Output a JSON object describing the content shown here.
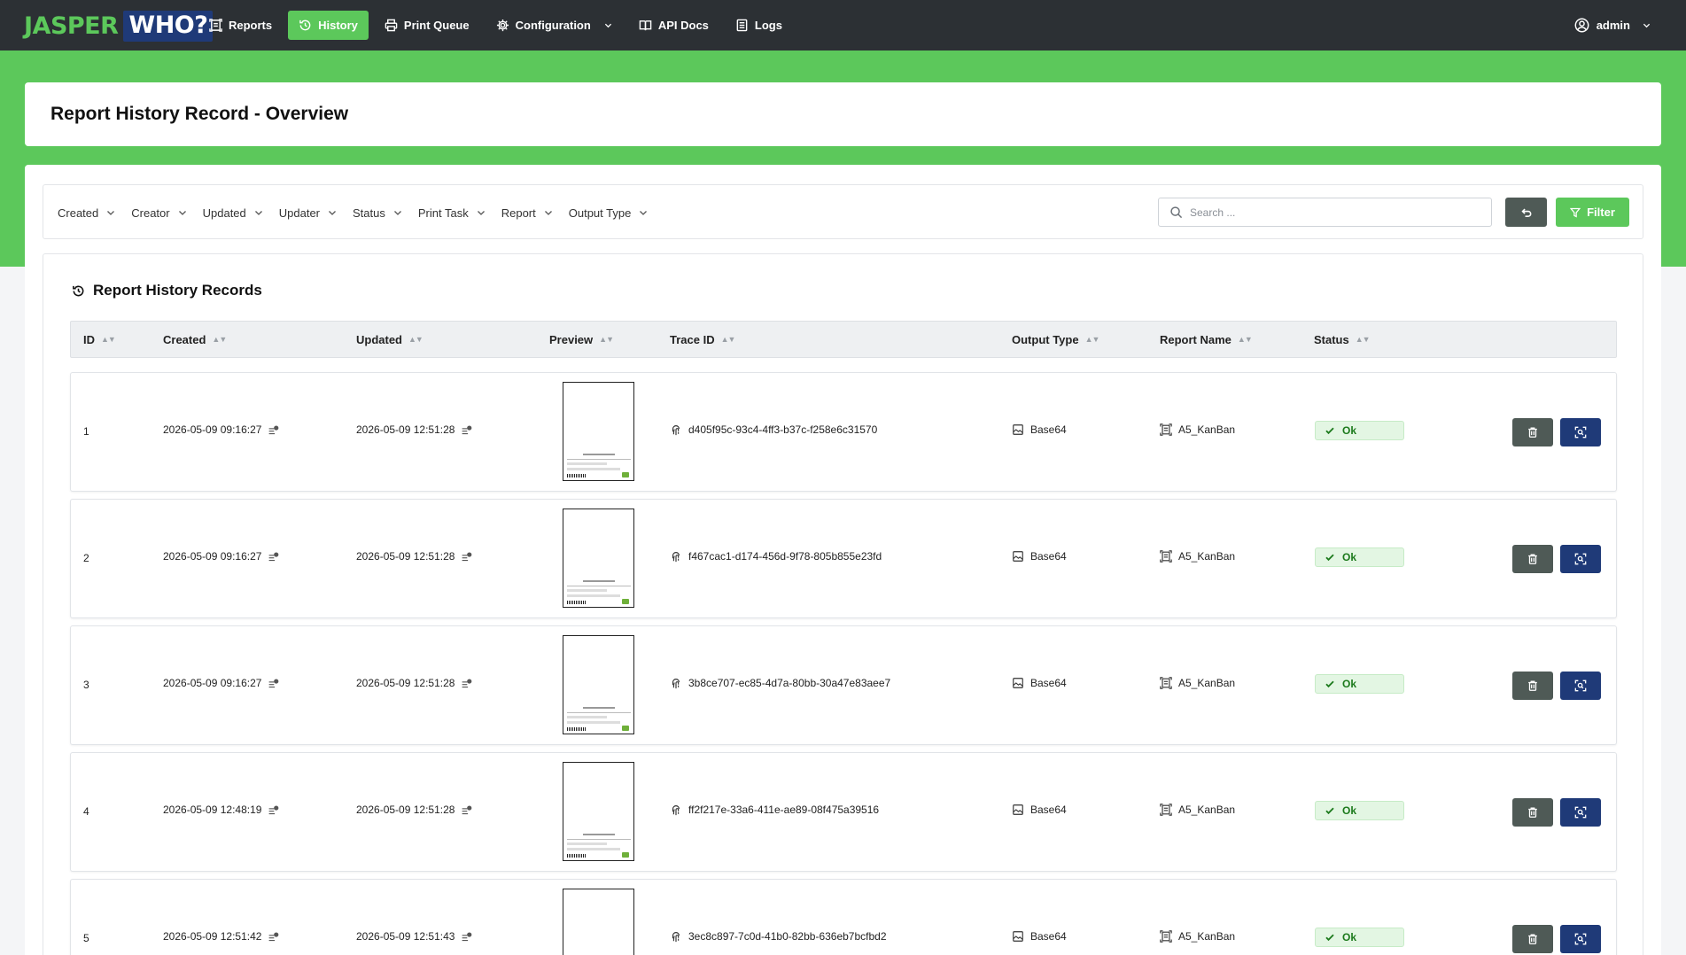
{
  "logo": {
    "part1": "JASPER",
    "part2": "WHO?"
  },
  "nav": {
    "items": [
      {
        "label": "Reports",
        "icon": "report-icon"
      },
      {
        "label": "History",
        "icon": "history-icon",
        "active": true
      },
      {
        "label": "Print Queue",
        "icon": "printer-icon"
      },
      {
        "label": "Configuration",
        "icon": "gear-icon",
        "dropdown": true
      },
      {
        "label": "API Docs",
        "icon": "book-icon"
      },
      {
        "label": "Logs",
        "icon": "list-icon"
      }
    ],
    "user": {
      "name": "admin",
      "icon": "user-circle-icon"
    }
  },
  "page": {
    "title": "Report History Record - Overview"
  },
  "filters": {
    "items": [
      "Created",
      "Creator",
      "Updated",
      "Updater",
      "Status",
      "Print Task",
      "Report",
      "Output Type"
    ],
    "search_placeholder": "Search ...",
    "filter_label": "Filter"
  },
  "records": {
    "title": "Report History Records",
    "columns": {
      "id": "ID",
      "created": "Created",
      "updated": "Updated",
      "preview": "Preview",
      "trace_id": "Trace ID",
      "output_type": "Output Type",
      "report_name": "Report Name",
      "status": "Status"
    },
    "rows": [
      {
        "id": "1",
        "created": "2026-05-09 09:16:27",
        "updated": "2026-05-09 12:51:28",
        "trace_id": "d405f95c-93c4-4ff3-b37c-f258e6c31570",
        "output_type": "Base64",
        "report_name": "A5_KanBan",
        "status": "Ok"
      },
      {
        "id": "2",
        "created": "2026-05-09 09:16:27",
        "updated": "2026-05-09 12:51:28",
        "trace_id": "f467cac1-d174-456d-9f78-805b855e23fd",
        "output_type": "Base64",
        "report_name": "A5_KanBan",
        "status": "Ok"
      },
      {
        "id": "3",
        "created": "2026-05-09 09:16:27",
        "updated": "2026-05-09 12:51:28",
        "trace_id": "3b8ce707-ec85-4d7a-80bb-30a47e83aee7",
        "output_type": "Base64",
        "report_name": "A5_KanBan",
        "status": "Ok"
      },
      {
        "id": "4",
        "created": "2026-05-09 12:48:19",
        "updated": "2026-05-09 12:51:28",
        "trace_id": "ff2f217e-33a6-411e-ae89-08f475a39516",
        "output_type": "Base64",
        "report_name": "A5_KanBan",
        "status": "Ok"
      },
      {
        "id": "5",
        "created": "2026-05-09 12:51:42",
        "updated": "2026-05-09 12:51:43",
        "trace_id": "3ec8c897-7c0d-41b0-82bb-636eb7bcfbd2",
        "output_type": "Base64",
        "report_name": "A5_KanBan",
        "status": "Ok"
      }
    ]
  },
  "colors": {
    "nav_bg": "#2c3034",
    "accent_green": "#5cc85b",
    "brand_blue": "#1f3a78",
    "delete_btn": "#4f5a56",
    "ok_bg": "#e3f6e3",
    "ok_text": "#1c7a1c"
  }
}
